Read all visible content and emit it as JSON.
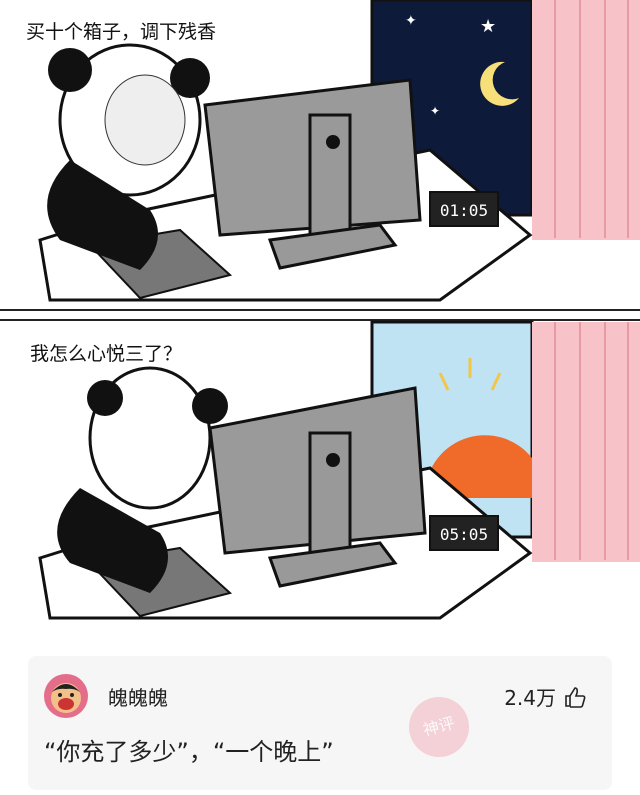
{
  "panels": [
    {
      "caption": "买十个箱子，调下残香",
      "clock": "01:05",
      "sky": "night"
    },
    {
      "caption": "我怎么心悦三了？",
      "clock": "05:05",
      "sky": "sunrise"
    }
  ],
  "comment": {
    "username": "魄魄魄",
    "likes": "2.4万",
    "text": "“你充了多少”，“一个晚上”",
    "stamp": "神评"
  },
  "colors": {
    "night": "#0d1a3a",
    "sky": "#bfe3f2",
    "sun": "#f06a2a",
    "curtain": "#f7c3c8",
    "card": "#f6f6f6"
  }
}
